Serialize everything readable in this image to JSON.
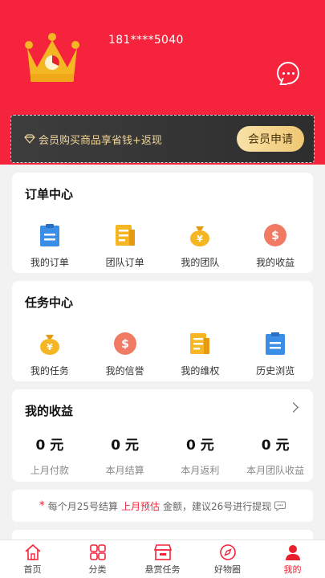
{
  "profile": {
    "phone": "181****5040"
  },
  "header": {
    "message_icon": "chat-bubble-icon"
  },
  "member": {
    "promo_text": "会员购买商品享省钱+返现",
    "apply_button": "会员申请"
  },
  "order_center": {
    "title": "订单中心",
    "items": [
      {
        "label": "我的订单",
        "icon": "order-list-icon"
      },
      {
        "label": "团队订单",
        "icon": "team-order-icon"
      },
      {
        "label": "我的团队",
        "icon": "money-bag-icon"
      },
      {
        "label": "我的收益",
        "icon": "dollar-coin-icon"
      }
    ]
  },
  "task_center": {
    "title": "任务中心",
    "items": [
      {
        "label": "我的任务",
        "icon": "money-bag-icon"
      },
      {
        "label": "我的信誉",
        "icon": "dollar-coin-icon"
      },
      {
        "label": "我的维权",
        "icon": "document-icon"
      },
      {
        "label": "历史浏览",
        "icon": "history-list-icon"
      }
    ]
  },
  "earnings": {
    "title": "我的收益",
    "items": [
      {
        "value": "0 元",
        "label": "上月付款"
      },
      {
        "value": "0 元",
        "label": "本月结算"
      },
      {
        "value": "0 元",
        "label": "本月返利"
      },
      {
        "value": "0 元",
        "label": "本月团队收益"
      }
    ]
  },
  "notice": {
    "prefix": "每个月25号结算",
    "highlight": "上月预估",
    "suffix": "金额，建议26号进行提现"
  },
  "tabbar": {
    "items": [
      {
        "label": "首页",
        "icon": "home-icon",
        "active": false
      },
      {
        "label": "分类",
        "icon": "category-grid-icon",
        "active": false
      },
      {
        "label": "悬赏任务",
        "icon": "store-icon",
        "active": false
      },
      {
        "label": "好物圈",
        "icon": "compass-icon",
        "active": false
      },
      {
        "label": "我的",
        "icon": "user-icon",
        "active": true
      }
    ]
  },
  "colors": {
    "brand_red": "#f5243c",
    "gold": "#efc773",
    "blue": "#3a8ee6",
    "yellow": "#f5b623",
    "salmon": "#f07a64"
  }
}
